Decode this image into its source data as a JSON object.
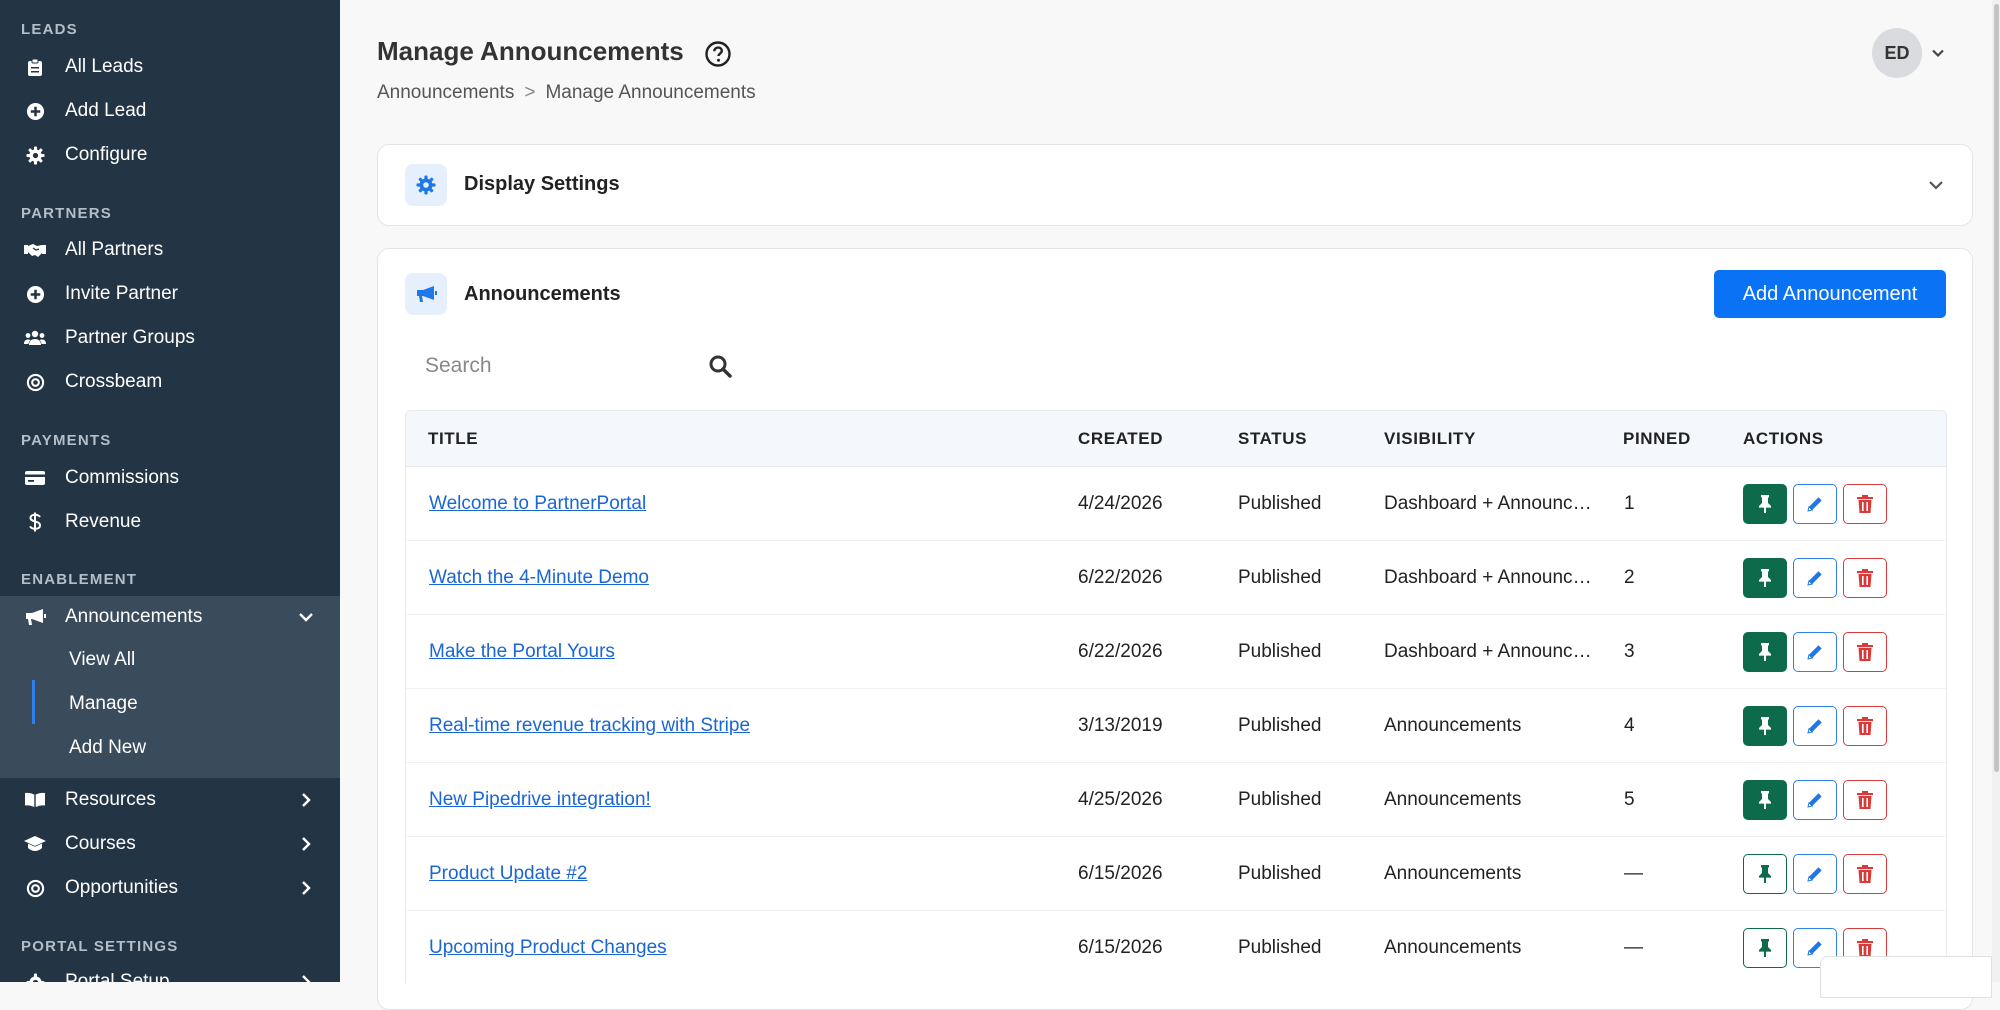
{
  "sidebar": {
    "sections": [
      {
        "title": "LEADS",
        "items": [
          {
            "label": "All Leads",
            "icon": "clipboard-icon"
          },
          {
            "label": "Add Lead",
            "icon": "plus-circle-icon"
          },
          {
            "label": "Configure",
            "icon": "gear-icon"
          }
        ]
      },
      {
        "title": "PARTNERS",
        "items": [
          {
            "label": "All Partners",
            "icon": "handshake-icon"
          },
          {
            "label": "Invite Partner",
            "icon": "plus-circle-icon"
          },
          {
            "label": "Partner Groups",
            "icon": "users-icon"
          },
          {
            "label": "Crossbeam",
            "icon": "target-icon"
          }
        ]
      },
      {
        "title": "PAYMENTS",
        "items": [
          {
            "label": "Commissions",
            "icon": "credit-card-icon"
          },
          {
            "label": "Revenue",
            "icon": "dollar-icon"
          }
        ]
      },
      {
        "title": "ENABLEMENT",
        "items": [
          {
            "label": "Announcements",
            "icon": "megaphone-icon",
            "expanded": true,
            "sub_items": [
              {
                "label": "View All"
              },
              {
                "label": "Manage",
                "active": true
              },
              {
                "label": "Add New"
              }
            ]
          },
          {
            "label": "Resources",
            "icon": "book-icon"
          },
          {
            "label": "Courses",
            "icon": "graduation-cap-icon"
          },
          {
            "label": "Opportunities",
            "icon": "target-icon"
          }
        ]
      },
      {
        "title": "PORTAL SETTINGS",
        "items": [
          {
            "label": "Portal Setup",
            "icon": "gear-icon"
          }
        ]
      }
    ]
  },
  "header": {
    "title": "Manage Announcements",
    "breadcrumb": [
      "Announcements",
      ">",
      "Manage Announcements"
    ],
    "user_initials": "ED"
  },
  "display_settings": {
    "title": "Display Settings"
  },
  "announcements": {
    "title": "Announcements",
    "add_button": "Add Announcement",
    "search_placeholder": "Search",
    "columns": [
      "TITLE",
      "CREATED",
      "STATUS",
      "VISIBILITY",
      "PINNED",
      "ACTIONS"
    ],
    "rows": [
      {
        "title": "Welcome to PartnerPortal",
        "created": "4/24/2026",
        "status": "Published",
        "visibility": "Dashboard + Announcements",
        "pinned": "1",
        "is_pinned": true
      },
      {
        "title": "Watch the 4-Minute Demo",
        "created": "6/22/2026",
        "status": "Published",
        "visibility": "Dashboard + Announcements",
        "pinned": "2",
        "is_pinned": true
      },
      {
        "title": "Make the Portal Yours",
        "created": "6/22/2026",
        "status": "Published",
        "visibility": "Dashboard + Announcements",
        "pinned": "3",
        "is_pinned": true
      },
      {
        "title": "Real-time revenue tracking with Stripe",
        "created": "3/13/2019",
        "status": "Published",
        "visibility": "Announcements",
        "pinned": "4",
        "is_pinned": true
      },
      {
        "title": "New Pipedrive integration!",
        "created": "4/25/2026",
        "status": "Published",
        "visibility": "Announcements",
        "pinned": "5",
        "is_pinned": true
      },
      {
        "title": "Product Update #2",
        "created": "6/15/2026",
        "status": "Published",
        "visibility": "Announcements",
        "pinned": "—",
        "is_pinned": false
      },
      {
        "title": "Upcoming Product Changes",
        "created": "6/15/2026",
        "status": "Published",
        "visibility": "Announcements",
        "pinned": "—",
        "is_pinned": false
      }
    ]
  },
  "colors": {
    "sidebar_bg": "#233444",
    "sidebar_submenu_bg": "#3a4b5b",
    "primary": "#0a72f5",
    "pin_green": "#0d6b4c",
    "delete_red": "#d93b3b",
    "link_blue": "#1a66d6"
  }
}
